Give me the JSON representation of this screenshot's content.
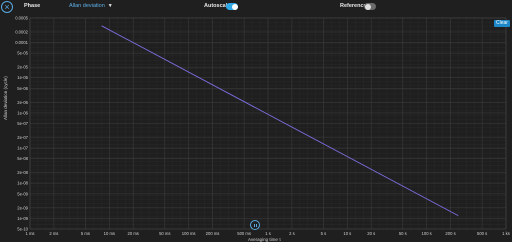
{
  "header": {
    "phase_label": "Phase",
    "metric_dropdown": "Allan deviation",
    "autoscale_label": "Autoscale",
    "autoscale_on": true,
    "reference_label": "Reference",
    "reference_on": false
  },
  "plot": {
    "clear_label": "Clear",
    "ylabel": "Allan deviation (cycle)",
    "xlabel": "Averaging time τ"
  },
  "colors": {
    "accent": "#2fa8e8",
    "line": "#7b6ee0",
    "grid": "#3a3a3a"
  },
  "chart_data": {
    "type": "line",
    "scale": "log-log",
    "grid": true,
    "xlabel": "Averaging time τ",
    "ylabel": "Allan deviation (cycle)",
    "xticks": [
      "1 ms",
      "2 ms",
      "5 ms",
      "10 ms",
      "20 ms",
      "50 ms",
      "100 ms",
      "200 ms",
      "500 ms",
      "1 s",
      "2 s",
      "5 s",
      "10 s",
      "20 s",
      "50 s",
      "100 s",
      "200 s",
      "500 s",
      "1 ks"
    ],
    "yticks": [
      "0.0005",
      "0.0002",
      "0.0001",
      "5e-05",
      "2e-05",
      "1e-05",
      "5e-06",
      "2e-06",
      "1e-06",
      "5e-07",
      "2e-07",
      "1e-07",
      "5e-08",
      "2e-08",
      "1e-08",
      "5e-09",
      "2e-09",
      "1e-09",
      "5e-10"
    ],
    "series": [
      {
        "x": [
          0.008,
          250
        ],
        "y": [
          0.0003,
          1.2e-09
        ]
      }
    ]
  }
}
